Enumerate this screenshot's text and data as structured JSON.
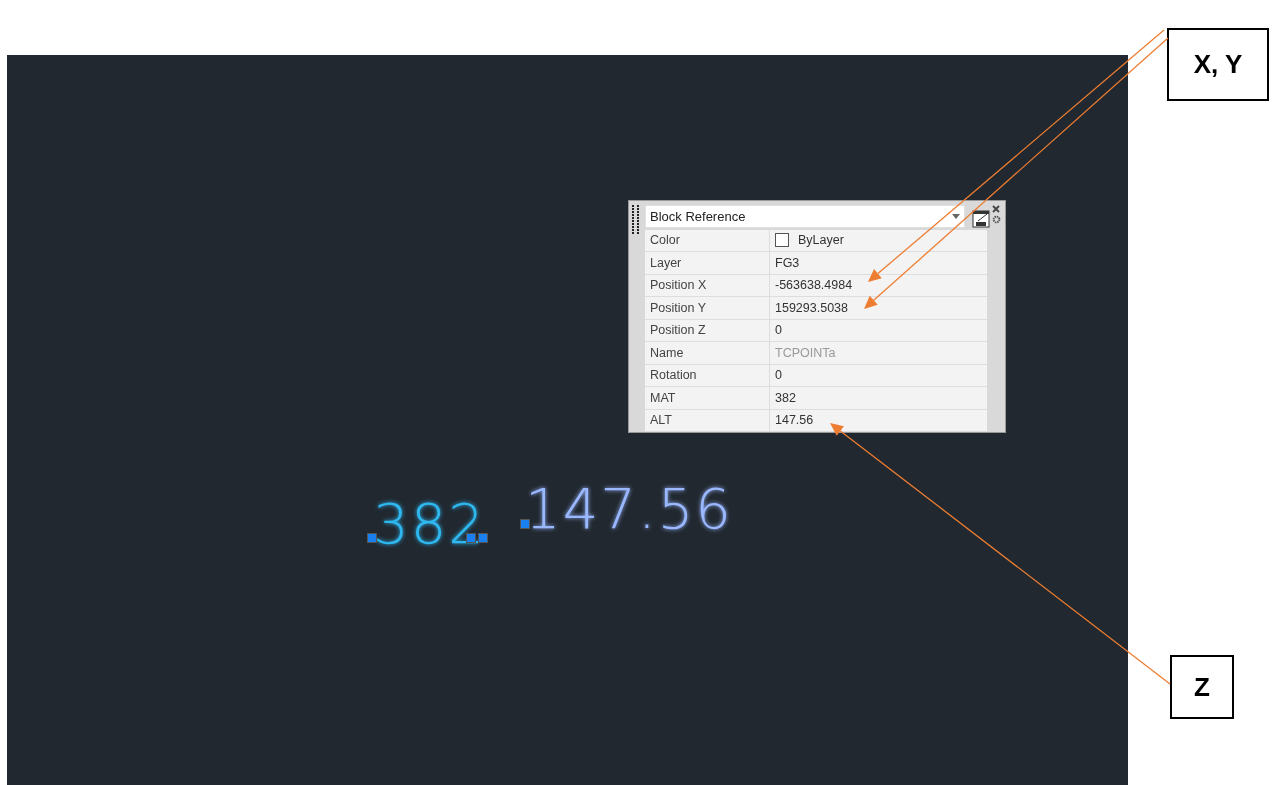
{
  "canvas": {
    "texts": [
      {
        "text": "382",
        "color": "#2fb8f0"
      },
      {
        "text": "147.56",
        "color": "#9ab8ff"
      }
    ]
  },
  "palette": {
    "object_type": "Block Reference",
    "properties": [
      {
        "label": "Color",
        "value": "ByLayer",
        "kind": "color",
        "disabled": false
      },
      {
        "label": "Layer",
        "value": "FG3",
        "kind": "text",
        "disabled": false
      },
      {
        "label": "Position X",
        "value": "-563638.4984",
        "kind": "text",
        "disabled": false
      },
      {
        "label": "Position Y",
        "value": "159293.5038",
        "kind": "text",
        "disabled": false
      },
      {
        "label": "Position Z",
        "value": "0",
        "kind": "text",
        "disabled": false
      },
      {
        "label": "Name",
        "value": "TCPOINTa",
        "kind": "text",
        "disabled": true
      },
      {
        "label": "Rotation",
        "value": "0",
        "kind": "text",
        "disabled": false
      },
      {
        "label": "MAT",
        "value": "382",
        "kind": "text",
        "disabled": false
      },
      {
        "label": "ALT",
        "value": "147.56",
        "kind": "text",
        "disabled": false
      }
    ]
  },
  "callouts": [
    {
      "label": "X, Y"
    },
    {
      "label": "Z"
    }
  ]
}
